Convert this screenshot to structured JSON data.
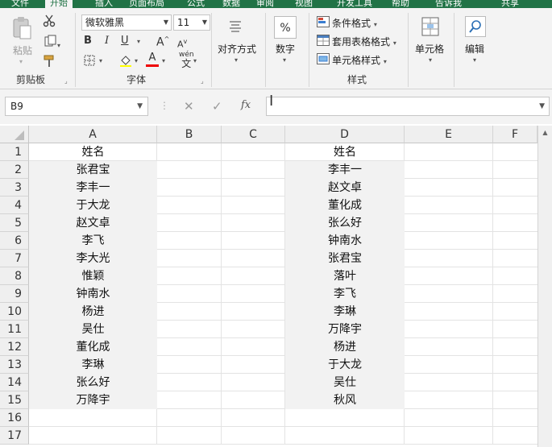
{
  "tabs": [
    "文件",
    "开始",
    "插入",
    "页面布局",
    "公式",
    "数据",
    "审阅",
    "视图",
    "开发工具",
    "帮助",
    "告诉我",
    "共享"
  ],
  "clipboard": {
    "paste_label": "粘贴",
    "group_label": "剪贴板"
  },
  "font": {
    "name": "微软雅黑",
    "size": "11",
    "group_label": "字体",
    "bold": "B",
    "italic": "I",
    "underline": "U",
    "grow": "A",
    "shrink": "A",
    "font_color_glyph": "A",
    "phonetic": "wén",
    "phonetic_char": "文"
  },
  "alignment": {
    "label": "对齐方式"
  },
  "number": {
    "label": "数字",
    "icon_glyph": "%"
  },
  "styles": {
    "conditional": "条件格式",
    "table": "套用表格格式",
    "cell": "单元格样式",
    "group_label": "样式"
  },
  "cells": {
    "label": "单元格"
  },
  "editing": {
    "label": "编辑"
  },
  "formula_bar": {
    "name_box": "B9",
    "fx": "fx",
    "content": ""
  },
  "sheet": {
    "columns": [
      "A",
      "B",
      "C",
      "D",
      "E",
      "F"
    ],
    "rows": [
      "1",
      "2",
      "3",
      "4",
      "5",
      "6",
      "7",
      "8",
      "9",
      "10",
      "11",
      "12",
      "13",
      "14",
      "15",
      "16",
      "17"
    ],
    "col_a": [
      "姓名",
      "张君宝",
      "李丰一",
      "于大龙",
      "赵文卓",
      "李飞",
      "李大光",
      "惟颖",
      "钟南水",
      "杨进",
      "吴仕",
      "董化成",
      "李琳",
      "张么好",
      "万降宇"
    ],
    "col_d": [
      "姓名",
      "李丰一",
      "赵文卓",
      "董化成",
      "张么好",
      "钟南水",
      "张君宝",
      "落叶",
      "李飞",
      "李琳",
      "万降宇",
      "杨进",
      "于大龙",
      "吴仕",
      "秋风"
    ]
  }
}
